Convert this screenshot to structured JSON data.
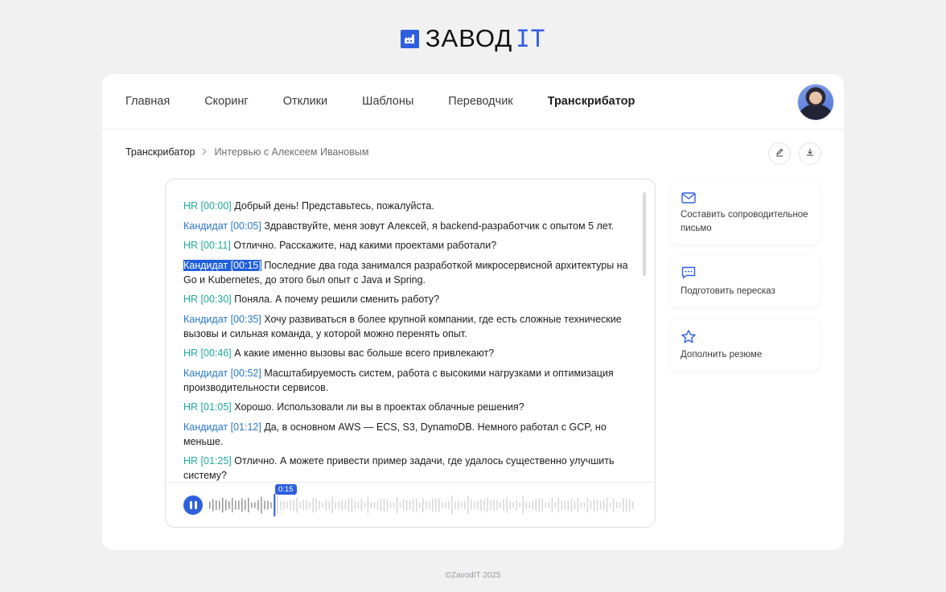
{
  "brand": {
    "name": "ЗАВОД",
    "name_suffix": "IT",
    "accent": "#2f5fe0"
  },
  "nav": {
    "items": [
      {
        "label": "Главная",
        "active": false
      },
      {
        "label": "Скоринг",
        "active": false
      },
      {
        "label": "Отклики",
        "active": false
      },
      {
        "label": "Шаблоны",
        "active": false
      },
      {
        "label": "Переводчик",
        "active": false
      },
      {
        "label": "Транскрибатор",
        "active": true
      }
    ]
  },
  "breadcrumb": {
    "root": "Транскрибатор",
    "separator": ">",
    "current": "Интервью с Алексеем Ивановым"
  },
  "toolbar": {
    "edit_icon": "pen-icon",
    "download_icon": "download-icon"
  },
  "transcript": {
    "lines": [
      {
        "speaker": "HR",
        "time": "[00:00]",
        "text": "Добрый день! Представьтесь, пожалуйста."
      },
      {
        "speaker": "Кандидат",
        "time": "[00:05]",
        "text": "Здравствуйте, меня зовут Алексей, я backend-разработчик с опытом 5 лет."
      },
      {
        "speaker": "HR",
        "time": "[00:11]",
        "text": "Отлично. Расскажите, над какими проектами работали?"
      },
      {
        "speaker": "Кандидат",
        "time": "[00:15]",
        "text": "Последние два года занимался разработкой микросервисной архитектуры на Go и Kubernetes, до этого был опыт с Java и Spring.",
        "selected": true
      },
      {
        "speaker": "HR",
        "time": "[00:30]",
        "text": "Поняла. А почему решили сменить работу?"
      },
      {
        "speaker": "Кандидат",
        "time": "[00:35]",
        "text": "Хочу развиваться в более крупной компании, где есть сложные технические вызовы и сильная команда, у которой можно перенять опыт."
      },
      {
        "speaker": "HR",
        "time": "[00:46]",
        "text": "А какие именно вызовы вас больше всего привлекают?"
      },
      {
        "speaker": "Кандидат",
        "time": "[00:52]",
        "text": "Масштабируемость систем, работа с высокими нагрузками и оптимизация производительности сервисов."
      },
      {
        "speaker": "HR",
        "time": "[01:05]",
        "text": "Хорошо. Использовали ли вы в проектах облачные решения?"
      },
      {
        "speaker": "Кандидат",
        "time": "[01:12]",
        "text": "Да, в основном AWS — ECS, S3, DynamoDB. Немного работал с GCP, но меньше."
      },
      {
        "speaker": "HR",
        "time": "[01:25]",
        "text": "Отлично. А можете привести пример задачи, где удалось существенно улучшить систему?"
      }
    ]
  },
  "player": {
    "current_time": "0:15",
    "progress": 0.15,
    "state": "playing",
    "icon": "pause-icon"
  },
  "actions": [
    {
      "label": "Составить сопроводительное письмо",
      "icon": "mail-icon"
    },
    {
      "label": "Подготовить пересказ",
      "icon": "chat-icon"
    },
    {
      "label": "Дополнить резюме",
      "icon": "star-icon"
    }
  ],
  "footer": {
    "text": "©ZavodIT 2025"
  }
}
